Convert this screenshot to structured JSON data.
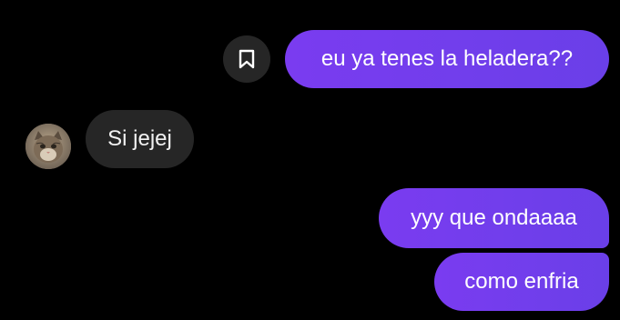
{
  "messages": [
    {
      "direction": "outgoing",
      "text": "eu ya tenes la heladera??"
    },
    {
      "direction": "incoming",
      "text": "Si jejej"
    },
    {
      "direction": "outgoing",
      "text": "yyy que ondaaaa"
    },
    {
      "direction": "outgoing",
      "text": "como enfria"
    }
  ],
  "icons": {
    "save": "bookmark-icon",
    "avatar": "cat-avatar"
  },
  "colors": {
    "background": "#000000",
    "outgoing_bubble": "#7040ec",
    "incoming_bubble": "#262626",
    "text": "#ffffff"
  }
}
